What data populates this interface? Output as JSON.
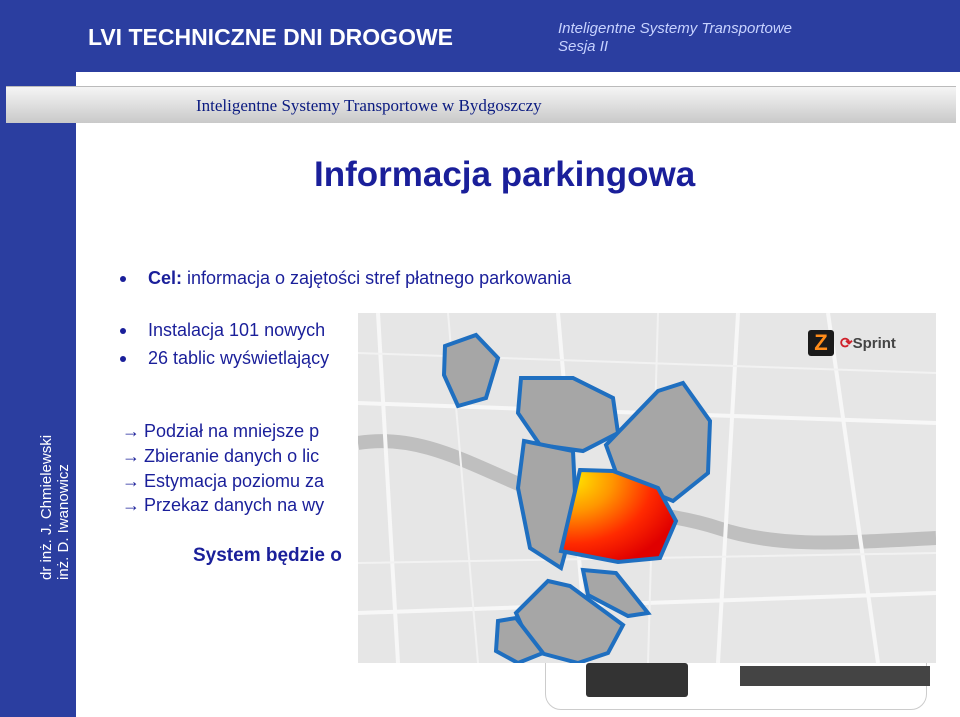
{
  "header": {
    "conference_title": "LVI TECHNICZNE DNI DROGOWE",
    "session_line1": "Inteligentne Systemy Transportowe",
    "session_line2": "Sesja II"
  },
  "subheader": {
    "text": "Inteligentne  Systemy  Transportowe  w  Bydgoszczy"
  },
  "sidebar": {
    "author1": "dr inż. J. Chmielewski",
    "author2": "inż. D. Iwanowicz"
  },
  "slide": {
    "title": "Informacja parkingowa",
    "bullets": [
      "Cel: informacja o zajętości stref płatnego parkowania",
      "Instalacja 101 nowych",
      "26 tablic wyświetlający"
    ],
    "arrow_items": [
      "Podział na mniejsze p",
      "Zbieranie danych o lic",
      "Estymacja poziomu za",
      "Przekaz danych na wy"
    ],
    "summary": "System będzie o"
  },
  "logos": {
    "z_mark": "Z",
    "sprint": "Sprint"
  },
  "colors": {
    "brand_blue": "#2b3ea0",
    "text_blue": "#1a1f9a",
    "zone_outline": "#1f6fc0",
    "hot_zone": "#ff2a00"
  },
  "icons": {
    "bullet": "bullet-dot-icon",
    "arrow": "right-arrow-icon"
  }
}
